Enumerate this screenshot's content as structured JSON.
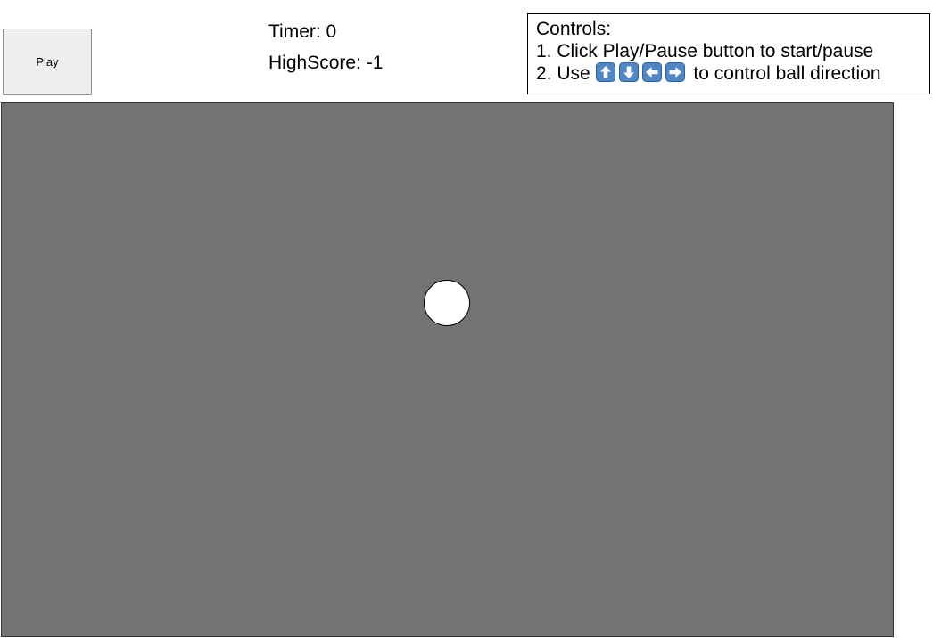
{
  "toolbar": {
    "play_label": "Play"
  },
  "stats": {
    "timer": "Timer: 0",
    "highscore": "HighScore: -1"
  },
  "controls": {
    "title": "Controls:",
    "line1": "1. Click Play/Pause button to start/pause",
    "line2_prefix": "2. Use",
    "line2_suffix": "to control ball direction",
    "key_icons": [
      "arrow-up-key-icon",
      "arrow-down-key-icon",
      "arrow-left-key-icon",
      "arrow-right-key-icon"
    ]
  },
  "colors": {
    "board": "#737373",
    "ball": "#ffffff",
    "key_icon": "#4f86c6"
  }
}
